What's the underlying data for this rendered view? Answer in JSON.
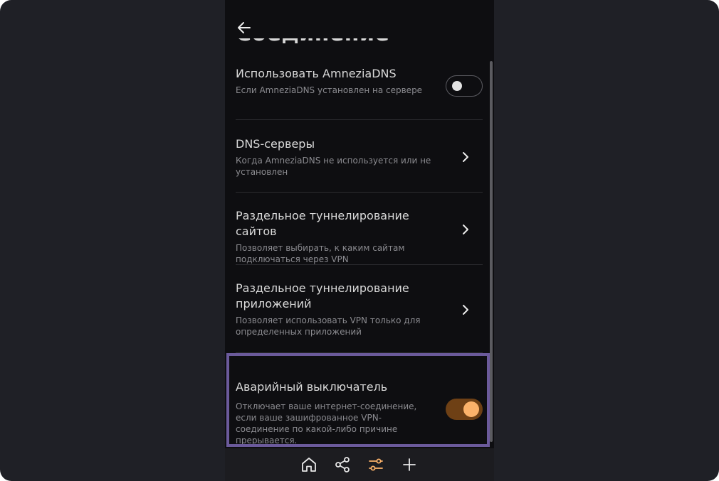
{
  "header": {
    "title": "Соединение",
    "back_icon": "arrow-left-icon"
  },
  "settings": {
    "amnezia_dns": {
      "title": "Использовать AmneziaDNS",
      "description": "Если AmneziaDNS установлен на сервере",
      "enabled": false
    },
    "dns_servers": {
      "title": "DNS-серверы",
      "description": "Когда AmneziaDNS не используется или не установлен"
    },
    "site_split_tunneling": {
      "title": "Раздельное туннелирование сайтов",
      "description": "Позволяет выбирать, к каким сайтам подключаться через VPN"
    },
    "app_split_tunneling": {
      "title": "Раздельное туннелирование приложений",
      "description": "Позволяет использовать VPN только для определенных приложений"
    },
    "kill_switch": {
      "title": "Аварийный выключатель",
      "description": "Отключает ваше интернет-соединение, если ваше зашифрованное VPN-соединение по какой-либо причине прерывается.",
      "enabled": true
    }
  },
  "bottom_nav": [
    {
      "icon": "home-icon",
      "active": false
    },
    {
      "icon": "share-icon",
      "active": false
    },
    {
      "icon": "settings-sliders-icon",
      "active": true
    },
    {
      "icon": "plus-icon",
      "active": false
    }
  ],
  "colors": {
    "accent": "#FBB26A",
    "toggle_on_track": "#6E4015",
    "highlight_border": "#6B5A9B",
    "background": "#0E0E11",
    "outer_background": "#1F2026"
  }
}
